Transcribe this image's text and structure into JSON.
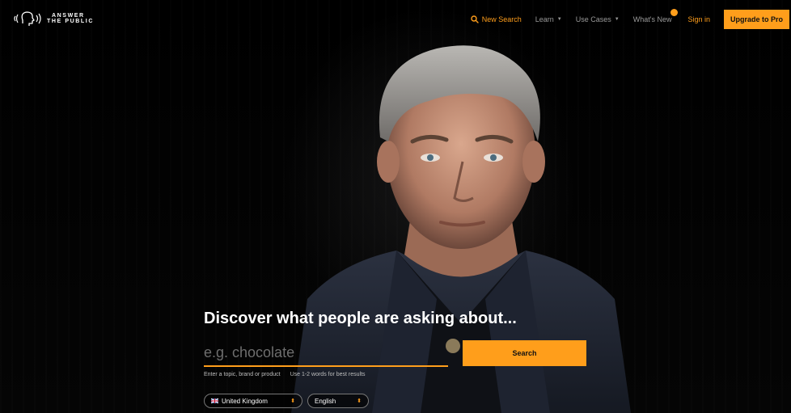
{
  "brand": {
    "name_line1": "ANSWER",
    "name_line2": "THE PUBLIC",
    "accent_color": "#ff9e1b"
  },
  "nav": {
    "new_search": {
      "label": "New Search",
      "icon": "search-icon"
    },
    "learn": {
      "label": "Learn"
    },
    "use_cases": {
      "label": "Use Cases"
    },
    "whats_new": {
      "label": "What's New"
    },
    "sign_in": {
      "label": "Sign in"
    },
    "upgrade": {
      "label": "Upgrade to Pro"
    }
  },
  "hero": {
    "headline": "Discover what people are asking about...",
    "search_placeholder": "e.g. chocolate",
    "search_button": "Search",
    "hint_left": "Enter a topic, brand or product",
    "hint_right": "Use 1-2 words for best results",
    "country": {
      "selected": "United Kingdom",
      "icon": "uk-flag-icon"
    },
    "language": {
      "selected": "English"
    }
  }
}
